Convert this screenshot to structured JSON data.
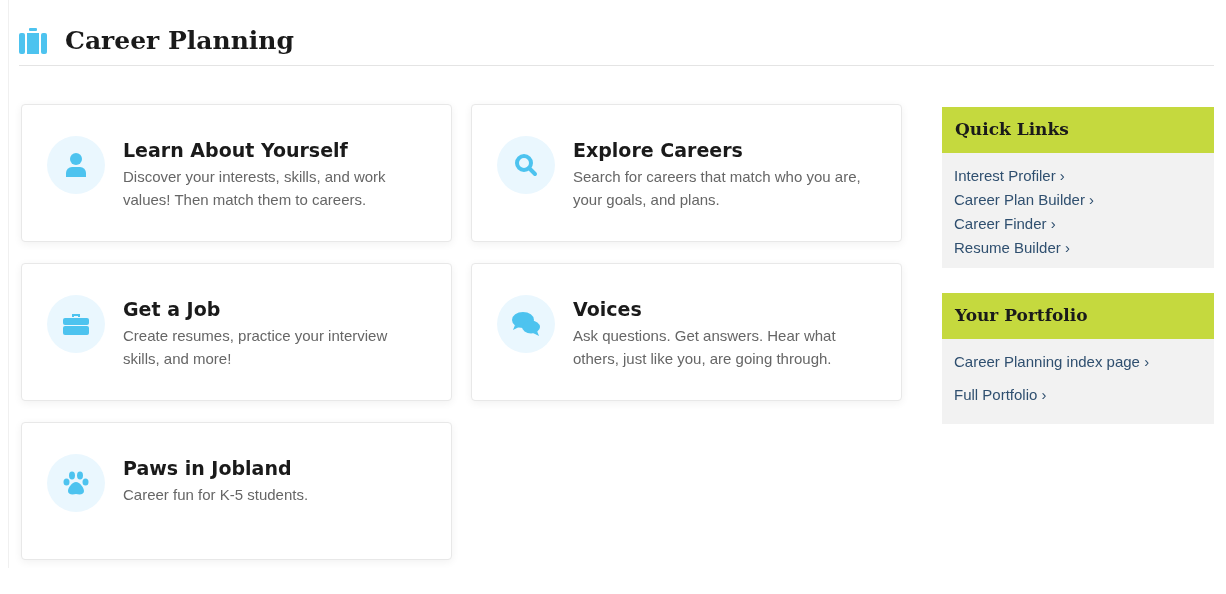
{
  "header": {
    "title": "Career Planning"
  },
  "cards": [
    {
      "kind": "person",
      "title": "Learn About Yourself",
      "text": "Discover your interests, skills, and work values! Then match them to careers."
    },
    {
      "kind": "search",
      "title": "Explore Careers",
      "text": "Search for careers that match who you are, your goals, and plans."
    },
    {
      "kind": "briefcase",
      "title": "Get a Job",
      "text": "Create resumes, practice your interview skills, and more!"
    },
    {
      "kind": "chat",
      "title": "Voices",
      "text": "Ask questions. Get answers. Hear what others, just like you, are going through."
    },
    {
      "kind": "paw",
      "title": "Paws in Jobland",
      "text": "Career fun for K-5 students."
    }
  ],
  "sidebar": [
    {
      "title": "Quick Links",
      "links": [
        "Interest Profiler ›",
        "Career Plan Builder ›",
        "Career Finder ›",
        "Resume Builder ›"
      ]
    },
    {
      "title": "Your Portfolio",
      "links": [
        "Career Planning index page ›",
        "Full Portfolio ›"
      ]
    }
  ]
}
